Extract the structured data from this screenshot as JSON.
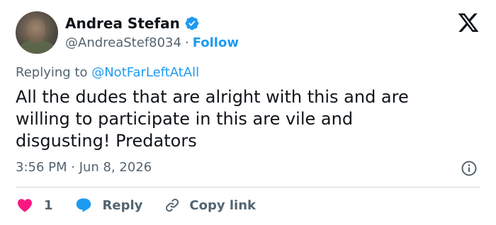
{
  "user": {
    "display_name": "Andrea Stefan",
    "handle": "@AndreaStef8034",
    "separator": "·",
    "follow_label": "Follow",
    "verified_color": "#1d9bf0"
  },
  "tweet": {
    "replying_prefix": "Replying to",
    "replying_to": "@NotFarLeftAtAll",
    "lines": [
      "All the dudes that are alright with this and are",
      "willing to participate in this are vile and",
      "disgusting! Predators"
    ],
    "timestamp": "3:56 PM · Jun 8, 2026"
  },
  "actions": {
    "like_count": "1",
    "reply_label": "Reply",
    "copy_label": "Copy link"
  },
  "icons": {
    "platform": "x-logo-icon",
    "verified": "verified-badge-icon",
    "info": "info-icon",
    "like": "heart-icon",
    "reply": "speech-bubble-icon",
    "copy": "link-icon"
  },
  "colors": {
    "accent": "#1d9bf0",
    "heart": "#f91880",
    "text": "#0f1419",
    "muted": "#536471"
  }
}
